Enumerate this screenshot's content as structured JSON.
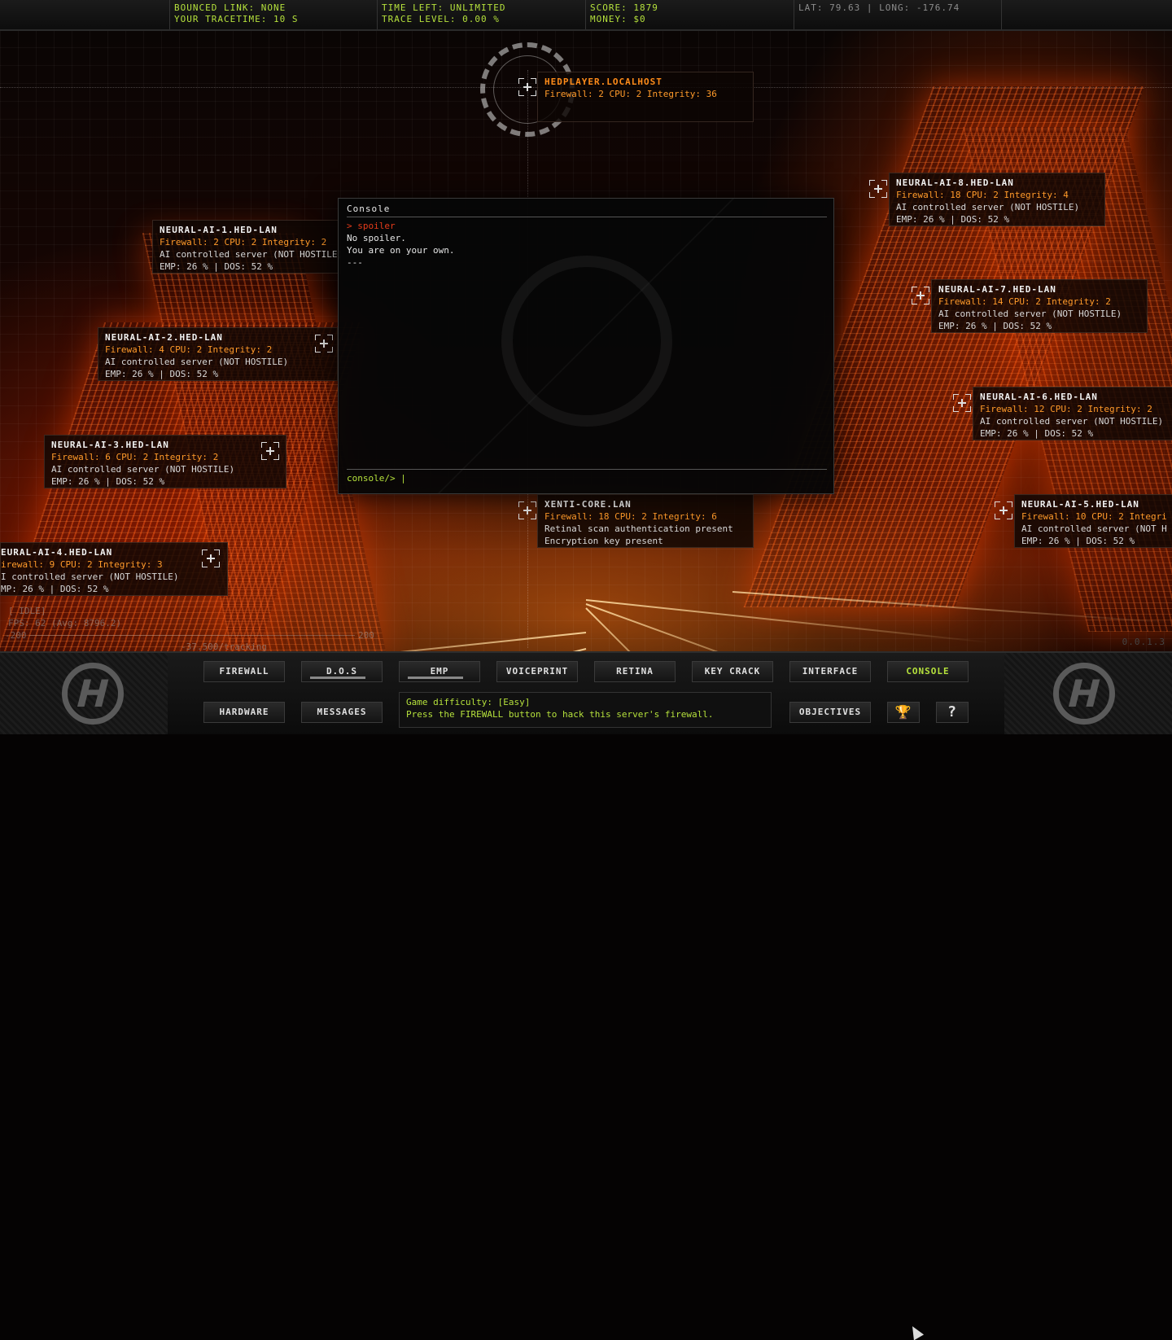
{
  "hud": {
    "bounced_link": "Bounced link: NONE",
    "trace_time": "Your tracetime: 10 s",
    "time_left": "Time left: UNLIMITED",
    "trace_level": "Trace level: 0.00 %",
    "score": "Score: 1879",
    "money": "Money: $0",
    "coords": "LAT: 79.63 | LONG: -176.74"
  },
  "player_node": {
    "name": "hedPlayer.localhost",
    "line1": "Firewall: 2 CPU: 2 Integrity: 36"
  },
  "nodes": [
    {
      "name": "neural-ai-1.hed-lan",
      "line1": "Firewall: 2 CPU: 2 Integrity: 2",
      "line2": "AI controlled server (NOT HOSTILE)",
      "line3": "EMP:  26 % | DOS:  52 %"
    },
    {
      "name": "neural-ai-2.hed-lan",
      "line1": "Firewall: 4 CPU: 2 Integrity: 2",
      "line2": "AI controlled server (NOT HOSTILE)",
      "line3": "EMP:  26 % | DOS:  52 %"
    },
    {
      "name": "neural-ai-3.hed-lan",
      "line1": "Firewall: 6 CPU: 2 Integrity: 2",
      "line2": "AI controlled server (NOT HOSTILE)",
      "line3": "EMP:  26 % | DOS:  52 %"
    },
    {
      "name": "eural-ai-4.hed-lan",
      "line1": "irewall: 9 CPU: 2 Integrity: 3",
      "line2": "I controlled server (NOT HOSTILE)",
      "line3": "MP:  26 % | DOS:  52 %"
    },
    {
      "name": "neural-ai-5.hed-lan",
      "line1": "Firewall: 10 CPU: 2 Integri",
      "line2": "AI controlled server (NOT H",
      "line3": "EMP:  26 % | DOS:  52 %"
    },
    {
      "name": "neural-ai-6.hed-lan",
      "line1": "Firewall: 12 CPU: 2 Integrity: 2",
      "line2": "AI controlled server (NOT HOSTILE)",
      "line3": "EMP:  26 % | DOS:  52 %"
    },
    {
      "name": "neural-ai-7.hed-lan",
      "line1": "Firewall: 14 CPU: 2 Integrity: 2",
      "line2": "AI controlled server (NOT HOSTILE)",
      "line3": "EMP:  26 % | DOS:  52 %"
    },
    {
      "name": "neural-ai-8.hed-lan",
      "line1": "Firewall: 18 CPU: 2 Integrity: 4",
      "line2": "AI controlled server (NOT HOSTILE)",
      "line3": "EMP:  26 % | DOS:  52 %"
    },
    {
      "name": "xenti-core.lan",
      "line1": "Firewall: 18 CPU: 2 Integrity: 6",
      "line2": "Retinal scan authentication present",
      "line3": "Encryption key present"
    }
  ],
  "console": {
    "title": "Console",
    "lines": [
      "> spoiler",
      "No spoiler.",
      "You are on your own.",
      "---"
    ],
    "prompt": "console/> |"
  },
  "fps_overlay": {
    "state": "[ IDLE]",
    "fps": "FPS:  62 (Avg: 8796.2)",
    "min": "-200",
    "max": "200",
    "tracking": "-37.500/tracking"
  },
  "toolbar": {
    "row1": [
      "FIREWALL",
      "D.O.S",
      "EMP",
      "VOICEPRINT",
      "RETINA",
      "KEY CRACK",
      "INTERFACE",
      "CONSOLE"
    ],
    "row2": [
      "HARDWARE",
      "MESSAGES",
      "OBJECTIVES"
    ],
    "trophy_icon": "🏆",
    "help_label": "?"
  },
  "status": {
    "line1": "Game difficulty: [Easy]",
    "line2": "Press the FIREWALL button to hack this server's firewall."
  },
  "version": "0.0.1.3",
  "colors": {
    "accent_green": "#b6e23c",
    "node_orange": "#ff9a2a",
    "console_red": "#e53b1a"
  }
}
